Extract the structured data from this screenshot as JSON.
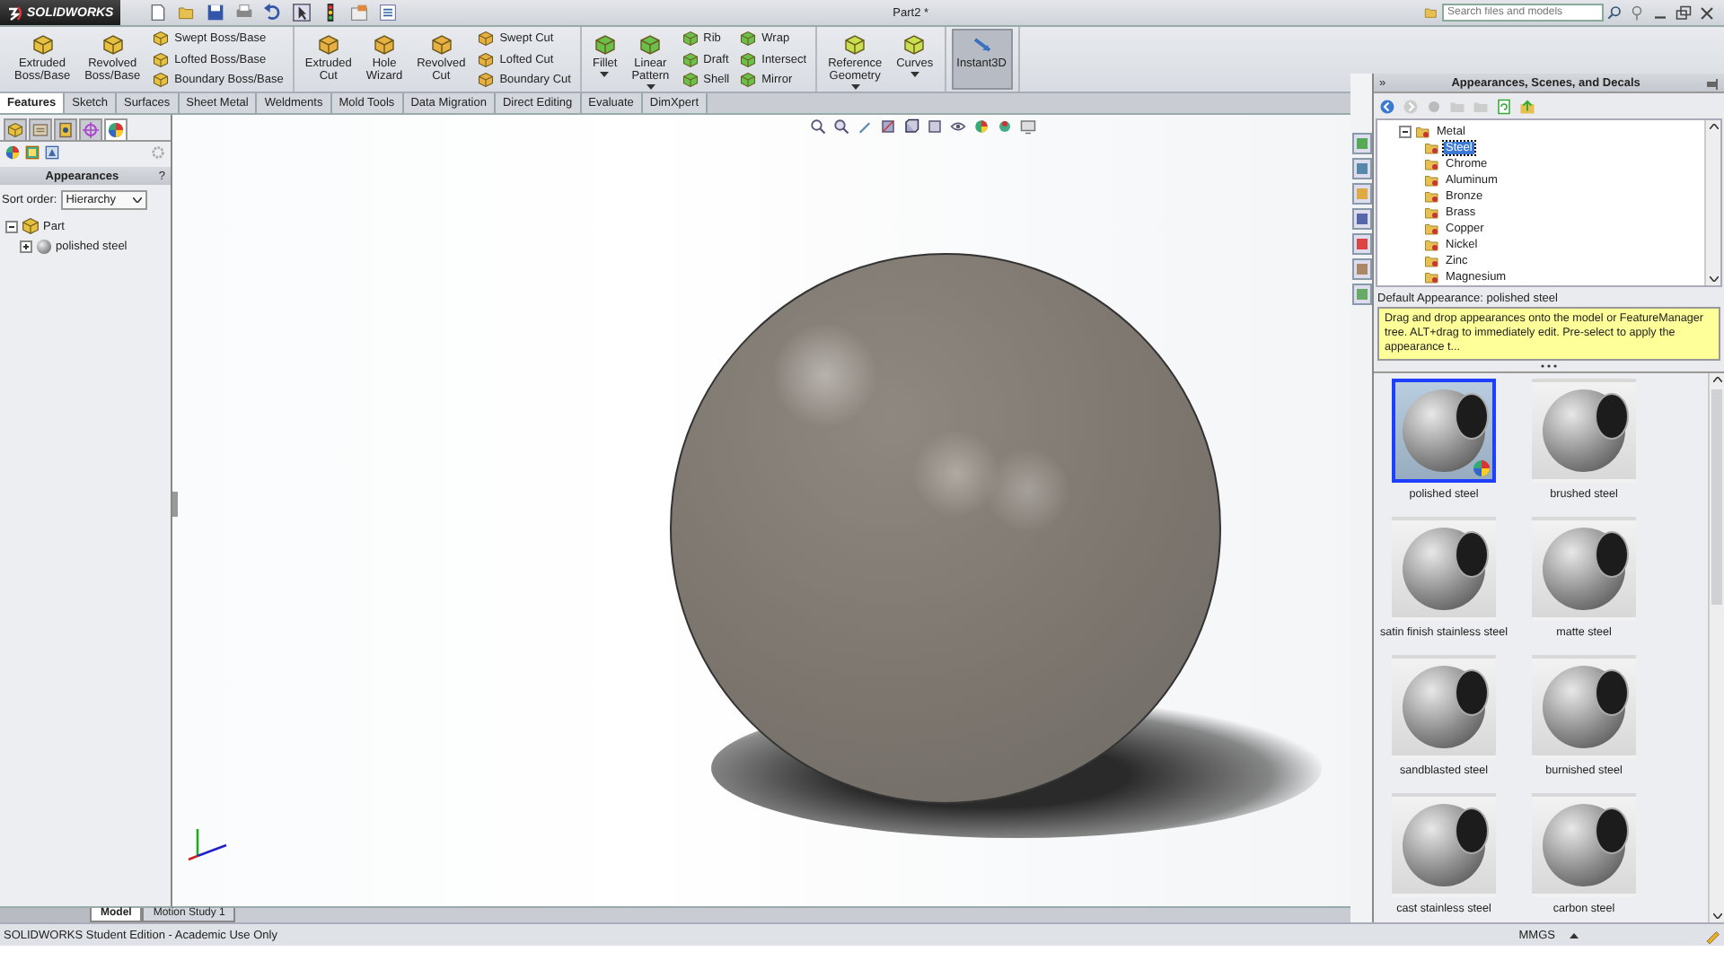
{
  "titlebar": {
    "logo": "SOLIDWORKS",
    "document_title": "Part2 *",
    "search": {
      "placeholder": "Search files and models"
    }
  },
  "command_manager": {
    "groups": [
      {
        "columns": [
          {
            "kind": "large",
            "label": "Extruded Boss/Base",
            "dropdown": false
          },
          {
            "kind": "large",
            "label": "Revolved Boss/Base",
            "dropdown": false
          },
          {
            "kind": "stack",
            "labels": [
              "Swept Boss/Base",
              "Lofted Boss/Base",
              "Boundary Boss/Base"
            ]
          }
        ]
      },
      {
        "columns": [
          {
            "kind": "large",
            "label": "Extruded Cut",
            "dropdown": false
          },
          {
            "kind": "large",
            "label": "Hole Wizard",
            "dropdown": false
          },
          {
            "kind": "large",
            "label": "Revolved Cut",
            "dropdown": false
          },
          {
            "kind": "stack",
            "labels": [
              "Swept Cut",
              "Lofted Cut",
              "Boundary Cut"
            ]
          }
        ]
      },
      {
        "columns": [
          {
            "kind": "large",
            "label": "Fillet",
            "dropdown": true
          },
          {
            "kind": "large",
            "label": "Linear Pattern",
            "dropdown": true
          },
          {
            "kind": "stack",
            "labels": [
              "Rib",
              "Draft",
              "Shell"
            ]
          },
          {
            "kind": "stack",
            "labels": [
              "Wrap",
              "Intersect",
              "Mirror"
            ]
          }
        ]
      },
      {
        "columns": [
          {
            "kind": "large",
            "label": "Reference Geometry",
            "dropdown": true
          },
          {
            "kind": "large",
            "label": "Curves",
            "dropdown": true
          }
        ]
      },
      {
        "columns": [
          {
            "kind": "toggle",
            "label": "Instant3D",
            "selected": true
          }
        ]
      }
    ]
  },
  "tabs": [
    {
      "label": "Features",
      "selected": true
    },
    {
      "label": "Sketch",
      "selected": false
    },
    {
      "label": "Surfaces",
      "selected": false
    },
    {
      "label": "Sheet Metal",
      "selected": false
    },
    {
      "label": "Weldments",
      "selected": false
    },
    {
      "label": "Mold Tools",
      "selected": false
    },
    {
      "label": "Data Migration",
      "selected": false
    },
    {
      "label": "Direct Editing",
      "selected": false
    },
    {
      "label": "Evaluate",
      "selected": false
    },
    {
      "label": "DimXpert",
      "selected": false
    }
  ],
  "left_panel": {
    "panel_tabs": [
      {
        "selected": false
      },
      {
        "selected": false
      },
      {
        "selected": false
      },
      {
        "selected": false
      },
      {
        "selected": true
      }
    ],
    "title": "Appearances",
    "help": "?",
    "sort_label": "Sort order:",
    "sort_value": "Hierarchy",
    "tree": [
      {
        "label": "Part",
        "expanded": true,
        "children": [
          {
            "label": "polished steel",
            "expanded": false
          }
        ]
      }
    ]
  },
  "right_panel": {
    "chevron": "»",
    "title": "Appearances, Scenes, and Decals",
    "tree": [
      {
        "label": "Metal",
        "expanded": true,
        "children": [
          {
            "label": "Steel",
            "selected": true
          },
          {
            "label": "Chrome",
            "selected": false
          },
          {
            "label": "Aluminum",
            "selected": false
          },
          {
            "label": "Bronze",
            "selected": false
          },
          {
            "label": "Brass",
            "selected": false
          },
          {
            "label": "Copper",
            "selected": false
          },
          {
            "label": "Nickel",
            "selected": false
          },
          {
            "label": "Zinc",
            "selected": false
          },
          {
            "label": "Magnesium",
            "selected": false
          }
        ]
      }
    ],
    "default_appearance": "Default Appearance: polished steel",
    "hint": "Drag and drop appearances onto the model or FeatureManager tree. ALT+drag to immediately edit.  Pre-select to apply the appearance t...",
    "swatches": [
      {
        "label": "polished steel",
        "selected": true
      },
      {
        "label": "brushed steel",
        "selected": false
      },
      {
        "label": "satin finish stainless steel",
        "selected": false
      },
      {
        "label": "matte steel",
        "selected": false
      },
      {
        "label": "sandblasted steel",
        "selected": false
      },
      {
        "label": "burnished steel",
        "selected": false
      },
      {
        "label": "cast stainless steel",
        "selected": false
      },
      {
        "label": "carbon steel",
        "selected": false
      }
    ]
  },
  "bottom_tabs": [
    {
      "label": "Model",
      "selected": true
    },
    {
      "label": "Motion Study 1",
      "selected": false
    }
  ],
  "status_bar": {
    "text": "SOLIDWORKS Student Edition - Academic Use Only",
    "units": "MMGS"
  }
}
